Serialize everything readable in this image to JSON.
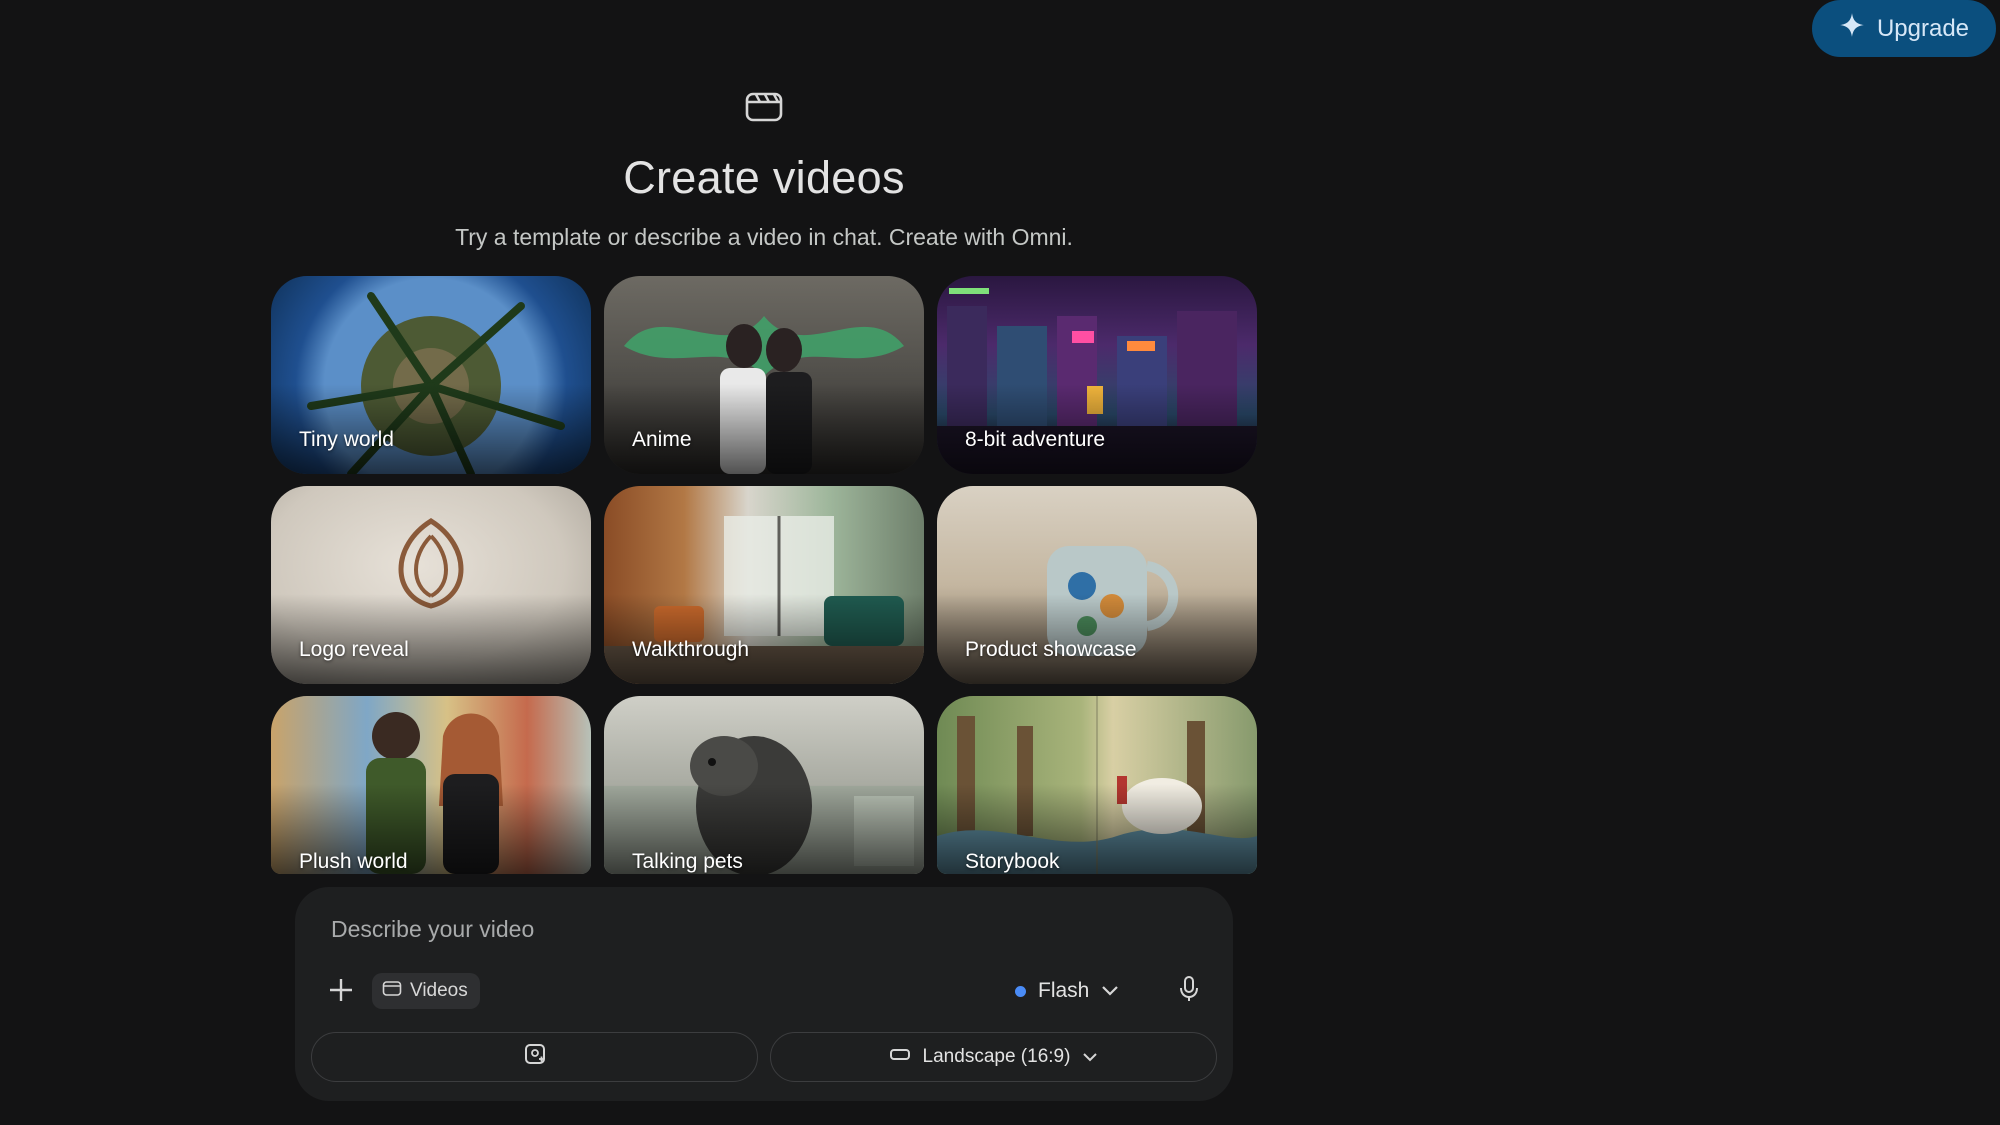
{
  "upgrade": {
    "label": "Upgrade",
    "icon": "sparkle-icon"
  },
  "header": {
    "icon": "video-clapper-icon",
    "title": "Create videos",
    "subtitle": "Try a template or describe a video in chat. Create with Omni."
  },
  "templates": [
    {
      "label": "Tiny world"
    },
    {
      "label": "Anime"
    },
    {
      "label": "8-bit adventure"
    },
    {
      "label": "Logo reveal"
    },
    {
      "label": "Walkthrough"
    },
    {
      "label": "Product showcase"
    },
    {
      "label": "Plush world"
    },
    {
      "label": "Talking pets"
    },
    {
      "label": "Storybook"
    }
  ],
  "composer": {
    "placeholder": "Describe your video",
    "chip_label": "Videos",
    "model_label": "Flash",
    "model_status_color": "#4a8cf7",
    "aspect_label": "Landscape (16:9)"
  },
  "colors": {
    "background": "#131314",
    "upgrade_bg": "#0b4f7e",
    "composer_bg": "#1e1f20"
  }
}
